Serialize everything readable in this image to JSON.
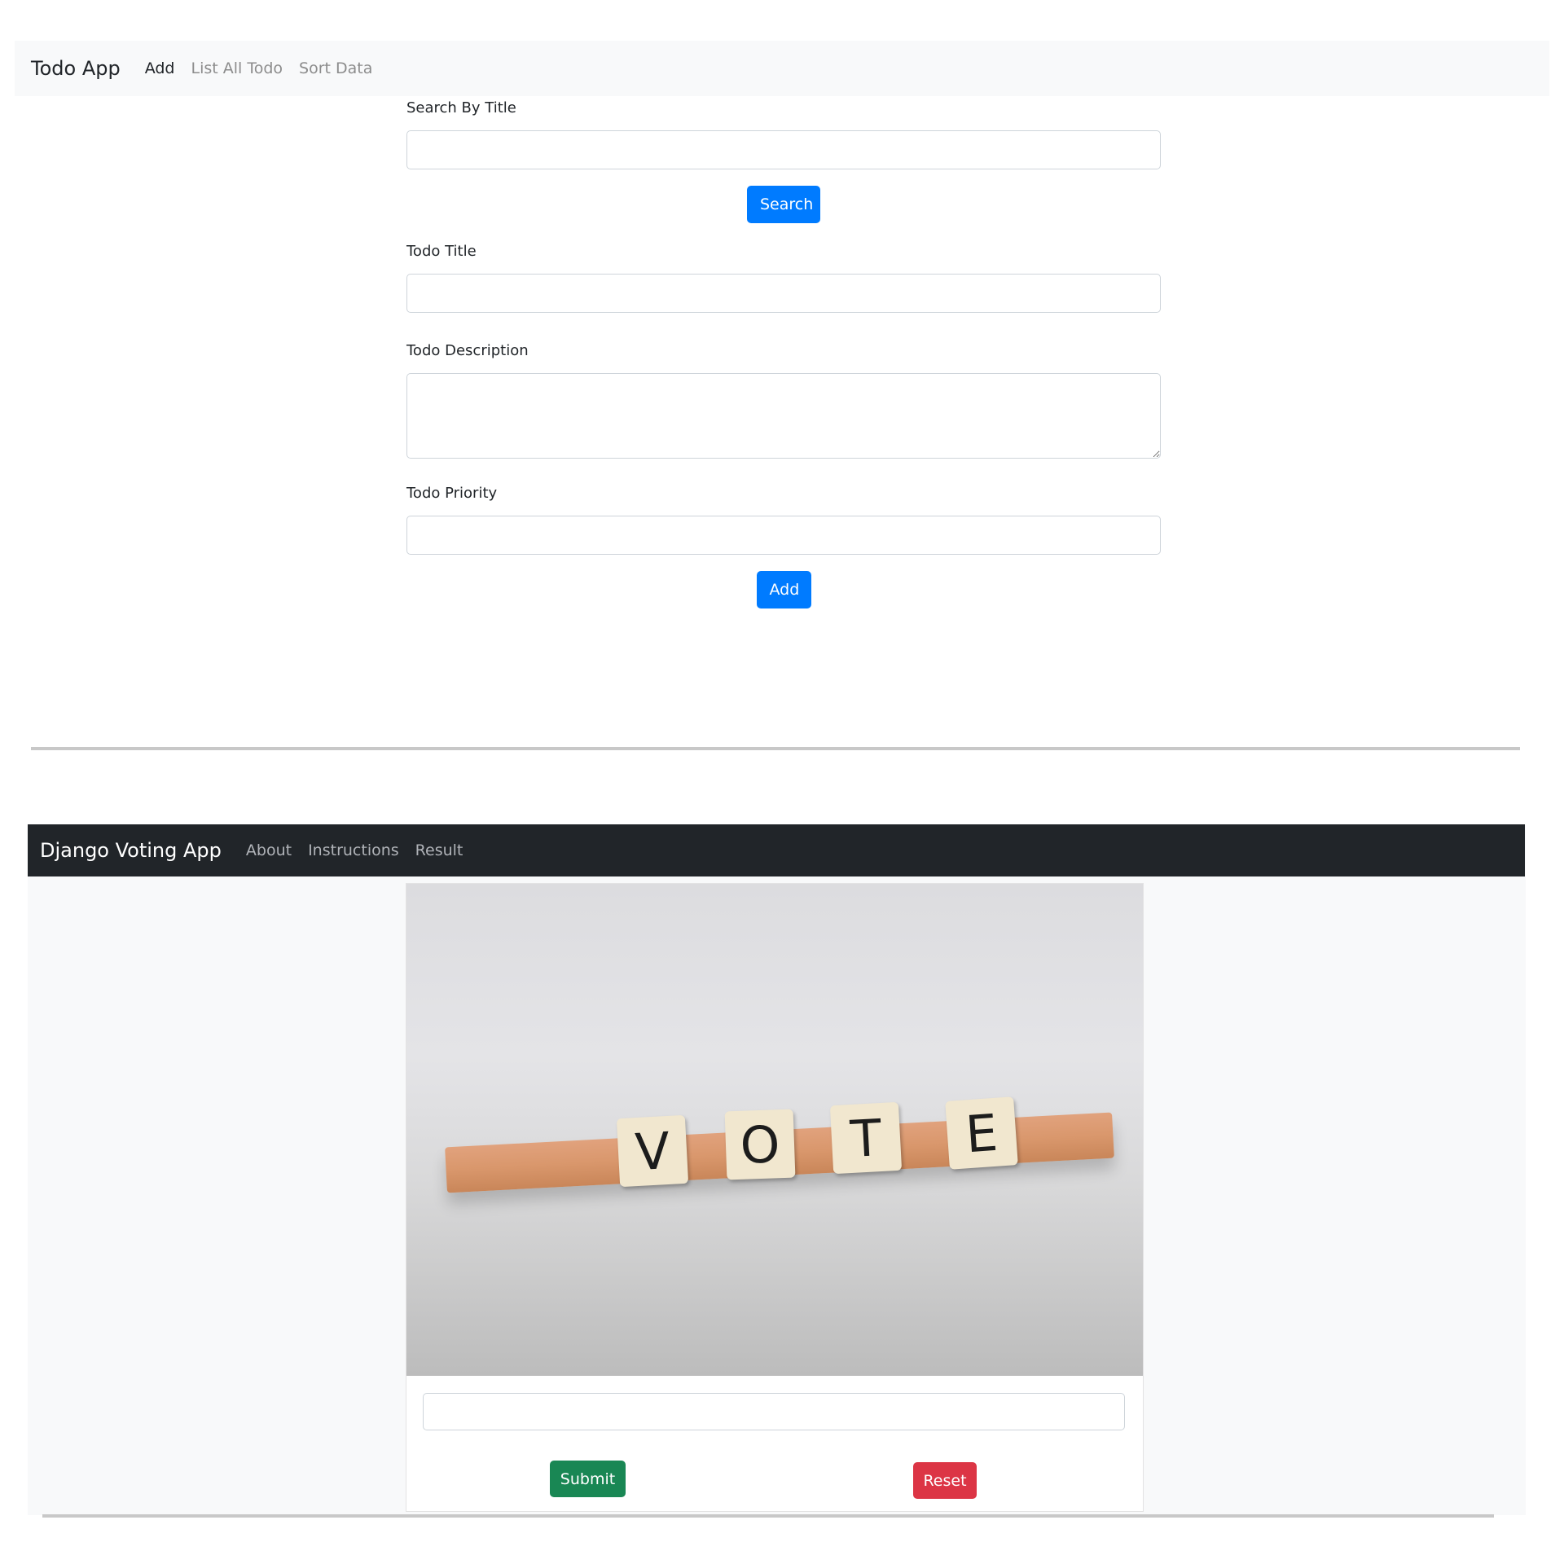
{
  "todo_app": {
    "brand": "Todo App",
    "nav": [
      {
        "label": "Add",
        "active": true
      },
      {
        "label": "List All Todo",
        "active": false
      },
      {
        "label": "Sort Data",
        "active": false
      }
    ],
    "search": {
      "label": "Search By Title",
      "value": "",
      "button": "Search"
    },
    "form": {
      "title_label": "Todo Title",
      "title_value": "",
      "description_label": "Todo Description",
      "description_value": "",
      "priority_label": "Todo Priority",
      "priority_value": "",
      "add_button": "Add"
    },
    "colors": {
      "primary": "#007bff",
      "navbar_bg": "#f8f9fa"
    }
  },
  "voting_app": {
    "brand": "Django Voting App",
    "nav": [
      {
        "label": "About"
      },
      {
        "label": "Instructions"
      },
      {
        "label": "Result"
      }
    ],
    "image": {
      "tiles": [
        "V",
        "O",
        "T",
        "E"
      ]
    },
    "vote_input_value": "",
    "submit_button": "Submit",
    "reset_button": "Reset",
    "colors": {
      "navbar_bg": "#212529",
      "success": "#198754",
      "danger": "#dc3545"
    }
  }
}
